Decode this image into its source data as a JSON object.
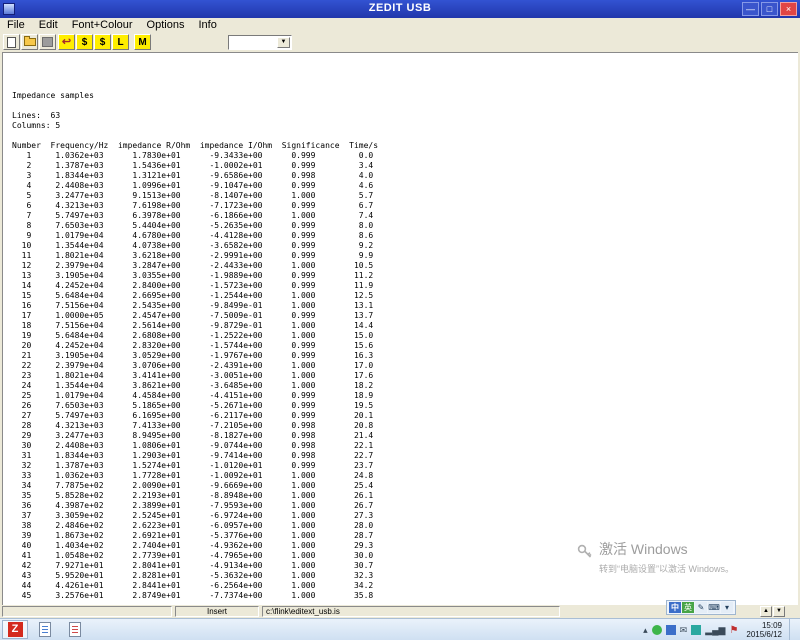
{
  "window": {
    "title": "ZEDIT USB"
  },
  "icons": {
    "minimize": "—",
    "maximize": "□",
    "close": "×",
    "undo": "↩",
    "combo_arrow": "▼",
    "scroll_up": "▲",
    "scroll_down": "▼",
    "tray_chevron": "▴",
    "mail": "✉",
    "flag": "⚑",
    "signal": "▂▄▆",
    "ime_zh": "中",
    "ime_pen": "✎",
    "ime_keyboard": "⌨",
    "ime_more": "▾",
    "ime_mode": "英"
  },
  "menu": {
    "items": [
      "File",
      "Edit",
      "Font+Colour",
      "Options",
      "Info"
    ]
  },
  "toolbar": {
    "dollar1": "$",
    "dollar2": "$",
    "l_button": "L",
    "m_button": "M",
    "combo_value": ""
  },
  "document": {
    "title_line": "Impedance samples",
    "lines_label": "Lines:  63",
    "columns_label": "Columns: 5",
    "header_line": "Number  Frequency/Hz  impedance R/Ohm  impedance I/Ohm  Significance  Time/s",
    "columns": [
      "Number",
      "Frequency/Hz",
      "impedance R/Ohm",
      "impedance I/Ohm",
      "Significance",
      "Time/s"
    ],
    "rows": [
      [
        1,
        "1.0362e+03",
        "1.7830e+01",
        "-9.3433e+00",
        "0.999",
        "0.0"
      ],
      [
        2,
        "1.3787e+03",
        "1.5436e+01",
        "-1.0002e+01",
        "0.999",
        "3.4"
      ],
      [
        3,
        "1.8344e+03",
        "1.3121e+01",
        "-9.6586e+00",
        "0.998",
        "4.0"
      ],
      [
        4,
        "2.4408e+03",
        "1.0996e+01",
        "-9.1047e+00",
        "0.999",
        "4.6"
      ],
      [
        5,
        "3.2477e+03",
        "9.1513e+00",
        "-8.1407e+00",
        "1.000",
        "5.7"
      ],
      [
        6,
        "4.3213e+03",
        "7.6198e+00",
        "-7.1723e+00",
        "0.999",
        "6.7"
      ],
      [
        7,
        "5.7497e+03",
        "6.3978e+00",
        "-6.1866e+00",
        "1.000",
        "7.4"
      ],
      [
        8,
        "7.6503e+03",
        "5.4404e+00",
        "-5.2635e+00",
        "0.999",
        "8.0"
      ],
      [
        9,
        "1.0179e+04",
        "4.6780e+00",
        "-4.4128e+00",
        "0.999",
        "8.6"
      ],
      [
        10,
        "1.3544e+04",
        "4.0738e+00",
        "-3.6582e+00",
        "0.999",
        "9.2"
      ],
      [
        11,
        "1.8021e+04",
        "3.6218e+00",
        "-2.9991e+00",
        "0.999",
        "9.9"
      ],
      [
        12,
        "2.3979e+04",
        "3.2847e+00",
        "-2.4433e+00",
        "1.000",
        "10.5"
      ],
      [
        13,
        "3.1905e+04",
        "3.0355e+00",
        "-1.9889e+00",
        "0.999",
        "11.2"
      ],
      [
        14,
        "4.2452e+04",
        "2.8400e+00",
        "-1.5723e+00",
        "0.999",
        "11.9"
      ],
      [
        15,
        "5.6484e+04",
        "2.6695e+00",
        "-1.2544e+00",
        "1.000",
        "12.5"
      ],
      [
        16,
        "7.5156e+04",
        "2.5435e+00",
        "-9.8499e-01",
        "1.000",
        "13.1"
      ],
      [
        17,
        "1.0000e+05",
        "2.4547e+00",
        "-7.5009e-01",
        "0.999",
        "13.7"
      ],
      [
        18,
        "7.5156e+04",
        "2.5614e+00",
        "-9.8729e-01",
        "1.000",
        "14.4"
      ],
      [
        19,
        "5.6484e+04",
        "2.6808e+00",
        "-1.2522e+00",
        "1.000",
        "15.0"
      ],
      [
        20,
        "4.2452e+04",
        "2.8320e+00",
        "-1.5744e+00",
        "0.999",
        "15.6"
      ],
      [
        21,
        "3.1905e+04",
        "3.0529e+00",
        "-1.9767e+00",
        "0.999",
        "16.3"
      ],
      [
        22,
        "2.3979e+04",
        "3.0706e+00",
        "-2.4391e+00",
        "1.000",
        "17.0"
      ],
      [
        23,
        "1.8021e+04",
        "3.4141e+00",
        "-3.0051e+00",
        "1.000",
        "17.6"
      ],
      [
        24,
        "1.3544e+04",
        "3.8621e+00",
        "-3.6485e+00",
        "1.000",
        "18.2"
      ],
      [
        25,
        "1.0179e+04",
        "4.4584e+00",
        "-4.4151e+00",
        "0.999",
        "18.9"
      ],
      [
        26,
        "7.6503e+03",
        "5.1865e+00",
        "-5.2671e+00",
        "0.999",
        "19.5"
      ],
      [
        27,
        "5.7497e+03",
        "6.1695e+00",
        "-6.2117e+00",
        "0.999",
        "20.1"
      ],
      [
        28,
        "4.3213e+03",
        "7.4133e+00",
        "-7.2105e+00",
        "0.998",
        "20.8"
      ],
      [
        29,
        "3.2477e+03",
        "8.9495e+00",
        "-8.1827e+00",
        "0.998",
        "21.4"
      ],
      [
        30,
        "2.4408e+03",
        "1.0806e+01",
        "-9.0744e+00",
        "0.998",
        "22.1"
      ],
      [
        31,
        "1.8344e+03",
        "1.2903e+01",
        "-9.7414e+00",
        "0.998",
        "22.7"
      ],
      [
        32,
        "1.3787e+03",
        "1.5274e+01",
        "-1.0120e+01",
        "0.999",
        "23.7"
      ],
      [
        33,
        "1.0362e+03",
        "1.7728e+01",
        "-1.0092e+01",
        "1.000",
        "24.8"
      ],
      [
        34,
        "7.7875e+02",
        "2.0090e+01",
        "-9.6669e+00",
        "1.000",
        "25.4"
      ],
      [
        35,
        "5.8528e+02",
        "2.2193e+01",
        "-8.8948e+00",
        "1.000",
        "26.1"
      ],
      [
        36,
        "4.3987e+02",
        "2.3899e+01",
        "-7.9593e+00",
        "1.000",
        "26.7"
      ],
      [
        37,
        "3.3059e+02",
        "2.5245e+01",
        "-6.9724e+00",
        "1.000",
        "27.3"
      ],
      [
        38,
        "2.4846e+02",
        "2.6223e+01",
        "-6.0957e+00",
        "1.000",
        "28.0"
      ],
      [
        39,
        "1.8673e+02",
        "2.6921e+01",
        "-5.3776e+00",
        "1.000",
        "28.7"
      ],
      [
        40,
        "1.4034e+02",
        "2.7404e+01",
        "-4.9362e+00",
        "1.000",
        "29.3"
      ],
      [
        41,
        "1.0548e+02",
        "2.7739e+01",
        "-4.7965e+00",
        "1.000",
        "30.0"
      ],
      [
        42,
        "7.9271e+01",
        "2.8041e+01",
        "-4.9134e+00",
        "1.000",
        "30.7"
      ],
      [
        43,
        "5.9520e+01",
        "2.8281e+01",
        "-5.3632e+00",
        "1.000",
        "32.3"
      ],
      [
        44,
        "4.4261e+01",
        "2.8441e+01",
        "-6.2564e+00",
        "1.000",
        "34.2"
      ],
      [
        45,
        "3.2576e+01",
        "2.8749e+01",
        "-7.7374e+00",
        "1.000",
        "35.8"
      ]
    ]
  },
  "statusbar": {
    "mode": "Insert",
    "path": "c:\\flink\\editext_usb.is"
  },
  "watermark": {
    "title": "激活 Windows",
    "subtitle": "转到“电脑设置”以激活 Windows。"
  },
  "taskbar": {
    "app1": "Z",
    "clock_time": "15:09",
    "clock_date": "2015/6/12"
  }
}
